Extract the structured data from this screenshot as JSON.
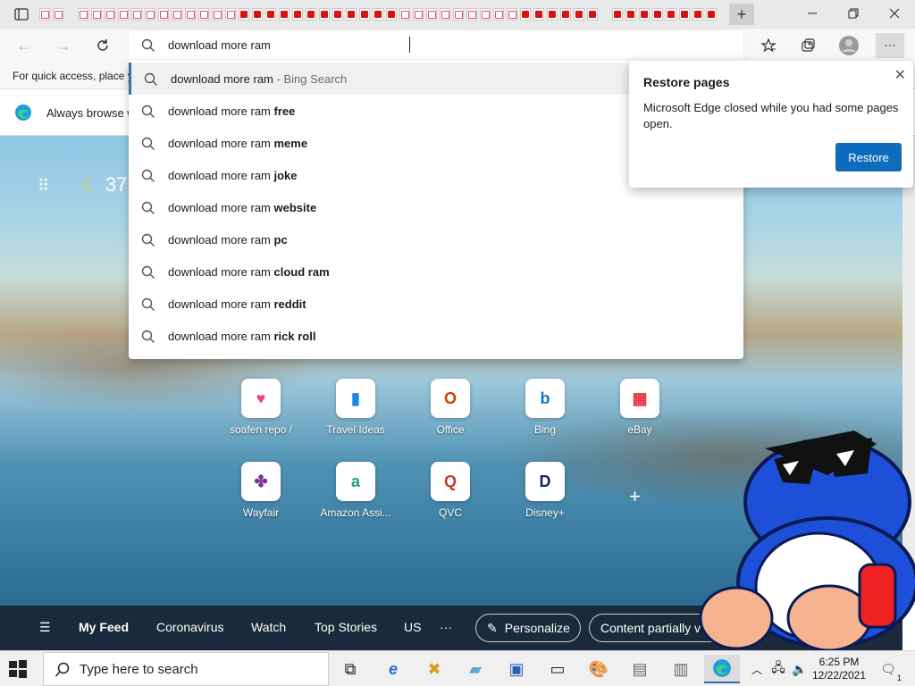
{
  "browser": {
    "new_tab_symbol": "+",
    "address_value": "download more ram",
    "favorites_hint": "For quick access, place y",
    "info_banner": "Always browse w"
  },
  "newtab": {
    "temperature": "37",
    "tiles": [
      {
        "label": "soafen repo /",
        "glyph": "♥",
        "color": "#e34a6f"
      },
      {
        "label": "Travel Ideas",
        "glyph": "▮",
        "color": "#1e88e5"
      },
      {
        "label": "Office",
        "glyph": "O",
        "color": "#d83b01"
      },
      {
        "label": "Bing",
        "glyph": "b",
        "color": "#0078d4"
      },
      {
        "label": "eBay",
        "glyph": "▦",
        "color": "#e53238"
      },
      {
        "label": "Wayfair",
        "glyph": "✤",
        "color": "#7b2f8e"
      },
      {
        "label": "Amazon Assi...",
        "glyph": "a",
        "color": "#16a085"
      },
      {
        "label": "QVC",
        "glyph": "Q",
        "color": "#c0392b"
      },
      {
        "label": "Disney+",
        "glyph": "D",
        "color": "#0b2a5a"
      }
    ],
    "add_symbol": "+"
  },
  "feed": {
    "items": [
      "My Feed",
      "Coronavirus",
      "Watch",
      "Top Stories",
      "US",
      "···"
    ],
    "personalize": "Personalize",
    "content_partial": "Content partially v"
  },
  "autocomplete": {
    "selected": {
      "base": "download more ram",
      "suffix": " - Bing Search"
    },
    "suggestions": [
      {
        "base": "download more ram ",
        "bold": "free"
      },
      {
        "base": "download more ram ",
        "bold": "meme"
      },
      {
        "base": "download more ram ",
        "bold": "joke"
      },
      {
        "base": "download more ram ",
        "bold": "website"
      },
      {
        "base": "download more ram ",
        "bold": "pc"
      },
      {
        "base": "download more ram ",
        "bold": "cloud ram"
      },
      {
        "base": "download more ram ",
        "bold": "reddit"
      },
      {
        "base": "download more ram ",
        "bold": "rick roll"
      }
    ]
  },
  "restore_popup": {
    "title": "Restore pages",
    "message": "Microsoft Edge closed while you had some pages open.",
    "button": "Restore"
  },
  "taskbar": {
    "search_placeholder": "Type here to search",
    "time": "6:25 PM",
    "date": "12/22/2021",
    "notification_count": "1"
  }
}
